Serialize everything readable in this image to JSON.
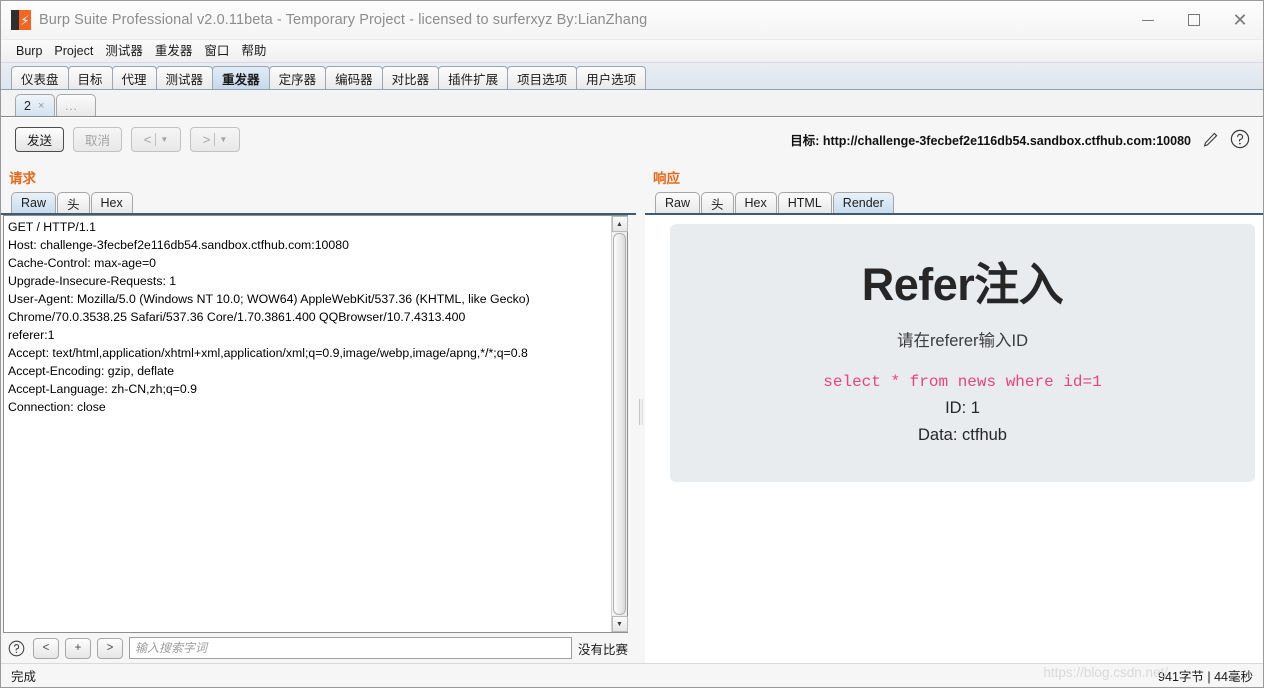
{
  "window": {
    "title": "Burp Suite Professional v2.0.11beta - Temporary Project - licensed to surferxyz By:LianZhang",
    "logo_icon": "burp-logo-icon",
    "minimize_label": "minimize-icon",
    "maximize_label": "maximize-icon",
    "close_label": "close-icon"
  },
  "menubar": {
    "items": [
      {
        "label": "Burp"
      },
      {
        "label": "Project"
      },
      {
        "label": "测试器"
      },
      {
        "label": "重发器"
      },
      {
        "label": "窗口"
      },
      {
        "label": "帮助"
      }
    ]
  },
  "main_tabs": {
    "selected_index": 4,
    "items": [
      {
        "label": "仪表盘"
      },
      {
        "label": "目标"
      },
      {
        "label": "代理"
      },
      {
        "label": "测试器"
      },
      {
        "label": "重发器"
      },
      {
        "label": "定序器"
      },
      {
        "label": "编码器"
      },
      {
        "label": "对比器"
      },
      {
        "label": "插件扩展"
      },
      {
        "label": "项目选项"
      },
      {
        "label": "用户选项"
      }
    ]
  },
  "repeater_tabs": {
    "items": [
      {
        "label": "2",
        "close": "×"
      },
      {
        "label": "...",
        "close": ""
      }
    ]
  },
  "toolbar": {
    "send_label": "发送",
    "cancel_label": "取消",
    "back_arrow": "<",
    "forward_arrow": ">",
    "caret": "▼",
    "target_label": "目标: http://challenge-3fecbef2e116db54.sandbox.ctfhub.com:10080",
    "edit_icon": "pencil-icon",
    "help_icon": "help-circle-icon"
  },
  "request": {
    "title": "请求",
    "tabs": [
      {
        "label": "Raw"
      },
      {
        "label": "头"
      },
      {
        "label": "Hex"
      }
    ],
    "selected_tab_index": 0,
    "raw": "GET / HTTP/1.1\nHost: challenge-3fecbef2e116db54.sandbox.ctfhub.com:10080\nCache-Control: max-age=0\nUpgrade-Insecure-Requests: 1\nUser-Agent: Mozilla/5.0 (Windows NT 10.0; WOW64) AppleWebKit/537.36 (KHTML, like Gecko)\nChrome/70.0.3538.25 Safari/537.36 Core/1.70.3861.400 QQBrowser/10.7.4313.400\nreferer:1\nAccept: text/html,application/xhtml+xml,application/xml;q=0.9,image/webp,image/apng,*/*;q=0.8\nAccept-Encoding: gzip, deflate\nAccept-Language: zh-CN,zh;q=0.9\nConnection: close"
  },
  "response": {
    "title": "响应",
    "tabs": [
      {
        "label": "Raw"
      },
      {
        "label": "头"
      },
      {
        "label": "Hex"
      },
      {
        "label": "HTML"
      },
      {
        "label": "Render"
      }
    ],
    "selected_tab_index": 4,
    "render": {
      "heading": "Refer注入",
      "subheading": "请在referer输入ID",
      "sql": "select * from news where id=1",
      "id_line": "ID: 1",
      "data_line": "Data: ctfhub",
      "sql_color": "#e8457a",
      "card_bg": "#e8ecef"
    }
  },
  "findbar": {
    "help_icon": "help-circle-icon",
    "prev_label": "<",
    "add_label": "+",
    "next_label": ">",
    "search_placeholder": "输入搜索字词",
    "search_value": "",
    "match_status": "没有比赛"
  },
  "statusbar": {
    "status": "完成",
    "metrics": "941字节 | 44毫秒",
    "watermark": "https://blog.csdn.net/"
  },
  "colors": {
    "accent_orange": "#e8691b",
    "tab_selected": "#c6d9ea",
    "brand": "#f26522"
  }
}
